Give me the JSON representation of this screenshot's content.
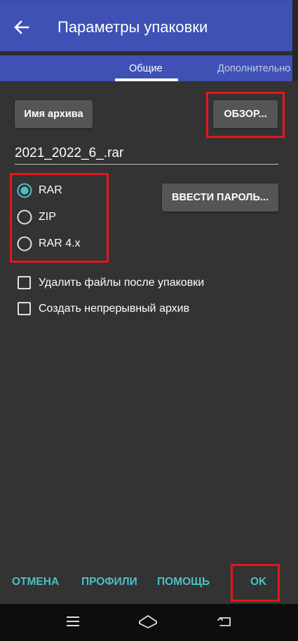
{
  "header": {
    "back_icon": "arrow-left-icon",
    "title": "Параметры упаковки"
  },
  "tabs": [
    {
      "label": "Общие",
      "active": true
    },
    {
      "label": "Дополнительно",
      "active": false
    }
  ],
  "archive": {
    "name_button": "Имя архива",
    "browse_button": "ОБЗОР...",
    "filename": "2021_2022_6_.rar",
    "password_button": "ВВЕСТИ ПАРОЛЬ..."
  },
  "formats": [
    {
      "label": "RAR",
      "selected": true
    },
    {
      "label": "ZIP",
      "selected": false
    },
    {
      "label": "RAR 4.x",
      "selected": false
    }
  ],
  "options": [
    {
      "label": "Удалить файлы после упаковки",
      "checked": false
    },
    {
      "label": "Создать непрерывный архив",
      "checked": false
    }
  ],
  "actions": {
    "cancel": "ОТМЕНА",
    "profiles": "ПРОФИЛИ",
    "help": "ПОМОЩЬ",
    "ok": "OK"
  },
  "navigation": {
    "icons": [
      "menu-icon",
      "home-icon",
      "back-icon"
    ]
  },
  "colors": {
    "appbar": "#3f51b5",
    "accent": "#4dbfc4",
    "background": "#333333",
    "highlight": "#e8141d"
  }
}
